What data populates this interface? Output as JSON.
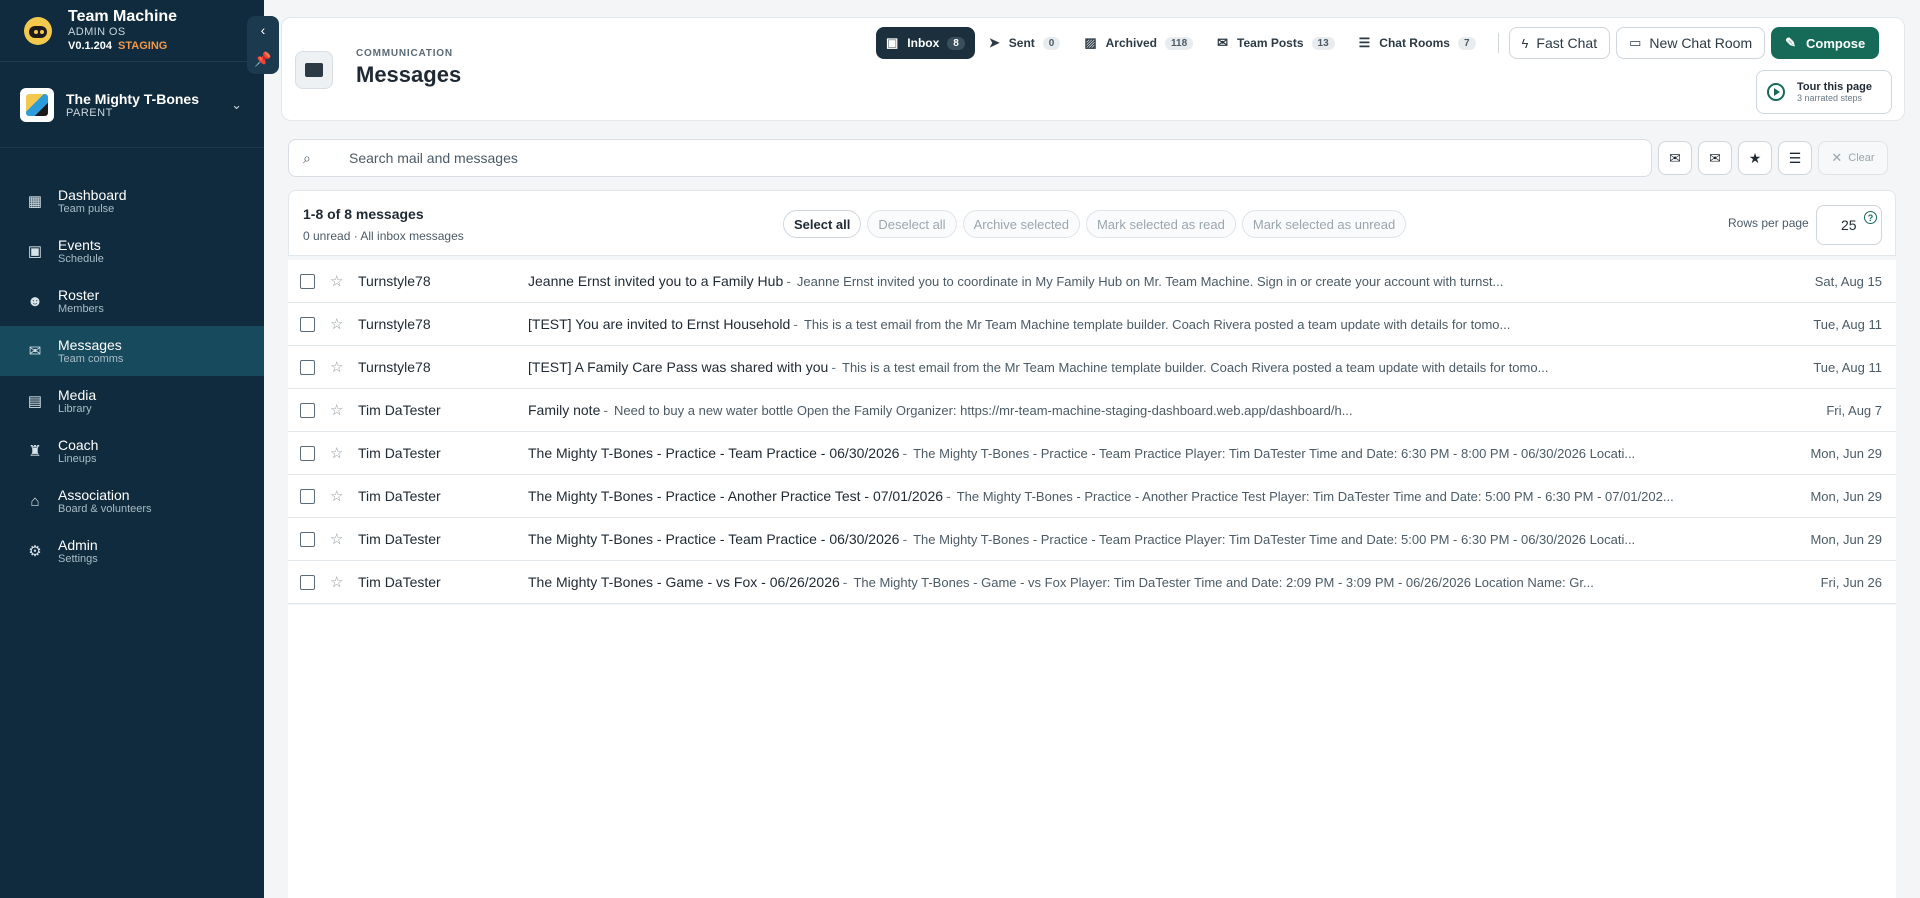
{
  "app": {
    "name": "Team Machine",
    "os": "ADMIN OS",
    "version": "V0.1.204",
    "env": "STAGING"
  },
  "team": {
    "name": "The Mighty T-Bones",
    "role": "PARENT"
  },
  "nav": [
    {
      "label": "Dashboard",
      "sub": "Team pulse",
      "icon": "dashboard-icon",
      "glyph": "▦"
    },
    {
      "label": "Events",
      "sub": "Schedule",
      "icon": "calendar-icon",
      "glyph": "▣"
    },
    {
      "label": "Roster",
      "sub": "Members",
      "icon": "people-icon",
      "glyph": "☻"
    },
    {
      "label": "Messages",
      "sub": "Team comms",
      "icon": "mail-icon",
      "glyph": "✉"
    },
    {
      "label": "Media",
      "sub": "Library",
      "icon": "media-icon",
      "glyph": "▤"
    },
    {
      "label": "Coach",
      "sub": "Lineups",
      "icon": "school-icon",
      "glyph": "♜"
    },
    {
      "label": "Association",
      "sub": "Board & volunteers",
      "icon": "building-icon",
      "glyph": "⌂"
    },
    {
      "label": "Admin",
      "sub": "Settings",
      "icon": "gear-icon",
      "glyph": "⚙"
    }
  ],
  "header": {
    "eyebrow": "COMMUNICATION",
    "title": "Messages"
  },
  "tabs": [
    {
      "label": "Inbox",
      "count": "8",
      "glyph": "▣",
      "icon": "inbox-icon"
    },
    {
      "label": "Sent",
      "count": "0",
      "glyph": "➤",
      "icon": "send-icon"
    },
    {
      "label": "Archived",
      "count": "118",
      "glyph": "▨",
      "icon": "archive-icon"
    },
    {
      "label": "Team Posts",
      "count": "13",
      "glyph": "✉",
      "icon": "mail-icon"
    },
    {
      "label": "Chat Rooms",
      "count": "7",
      "glyph": "☰",
      "icon": "chat-icon"
    }
  ],
  "buttons": {
    "fast_chat": "Fast Chat",
    "new_chat_room": "New Chat Room",
    "compose": "Compose",
    "tour_title": "Tour this page",
    "tour_sub": "3 narrated steps",
    "clear": "Clear"
  },
  "search": {
    "placeholder": "Search mail and messages"
  },
  "toolbar": {
    "count": "1-8 of 8 messages",
    "sub": "0 unread · All inbox messages",
    "actions": [
      "Select all",
      "Deselect all",
      "Archive selected",
      "Mark selected as read",
      "Mark selected as unread"
    ],
    "rows_label": "Rows per page",
    "rows_value": "25",
    "help": "?"
  },
  "messages": [
    {
      "sender": "Turnstyle78",
      "subject": "Jeanne Ernst invited you to a Family Hub",
      "snippet": "Jeanne Ernst invited you to coordinate in My Family Hub on Mr. Team Machine. Sign in or create your account with turnst...",
      "date": "Sat, Aug 15"
    },
    {
      "sender": "Turnstyle78",
      "subject": "[TEST] You are invited to Ernst Household",
      "snippet": "This is a test email from the Mr Team Machine template builder. Coach Rivera posted a team update with details for tomo...",
      "date": "Tue, Aug 11"
    },
    {
      "sender": "Turnstyle78",
      "subject": "[TEST] A Family Care Pass was shared with you",
      "snippet": "This is a test email from the Mr Team Machine template builder. Coach Rivera posted a team update with details for tomo...",
      "date": "Tue, Aug 11"
    },
    {
      "sender": "Tim DaTester",
      "subject": "Family note",
      "snippet": "Need to buy a new water bottle Open the Family Organizer: https://mr-team-machine-staging-dashboard.web.app/dashboard/h...",
      "date": "Fri, Aug 7"
    },
    {
      "sender": "Tim DaTester",
      "subject": "The Mighty T-Bones - Practice - Team Practice - 06/30/2026",
      "snippet": "The Mighty T-Bones - Practice - Team Practice Player: Tim DaTester Time and Date: 6:30 PM - 8:00 PM - 06/30/2026 Locati...",
      "date": "Mon, Jun 29"
    },
    {
      "sender": "Tim DaTester",
      "subject": "The Mighty T-Bones - Practice - Another Practice Test - 07/01/2026",
      "snippet": "The Mighty T-Bones - Practice - Another Practice Test Player: Tim DaTester Time and Date: 5:00 PM - 6:30 PM - 07/01/202...",
      "date": "Mon, Jun 29"
    },
    {
      "sender": "Tim DaTester",
      "subject": "The Mighty T-Bones - Practice - Team Practice - 06/30/2026",
      "snippet": "The Mighty T-Bones - Practice - Team Practice Player: Tim DaTester Time and Date: 5:00 PM - 6:30 PM - 06/30/2026 Locati...",
      "date": "Mon, Jun 29"
    },
    {
      "sender": "Tim DaTester",
      "subject": "The Mighty T-Bones - Game - vs Fox - 06/26/2026",
      "snippet": "The Mighty T-Bones - Game - vs Fox Player: Tim DaTester Time and Date: 2:09 PM - 3:09 PM - 06/26/2026 Location Name: Gr...",
      "date": "Fri, Jun 26"
    }
  ],
  "colors": {
    "sidebar": "#0f2b3d",
    "sidebar_active": "#174a5c",
    "primary": "#156b57",
    "staging": "#f2994a"
  }
}
